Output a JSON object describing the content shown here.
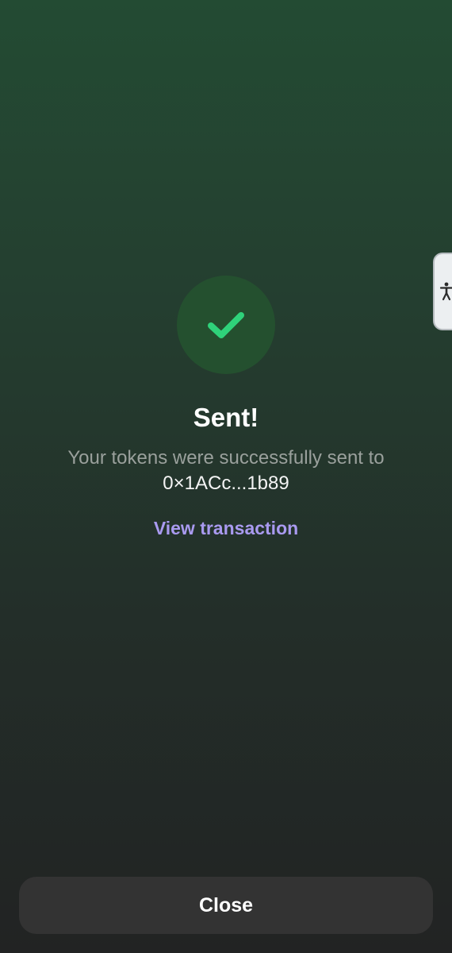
{
  "status": {
    "title": "Sent!",
    "message": "Your tokens were successfully sent to",
    "address": "0×1ACc...1b89",
    "link_label": "View transaction",
    "icon": "checkmark-icon"
  },
  "footer": {
    "close_label": "Close"
  },
  "accessibility": {
    "icon": "accessibility-icon"
  },
  "colors": {
    "accent_green": "#2fd27a",
    "link_purple": "#a99af0",
    "badge_bg": "#24502f"
  }
}
